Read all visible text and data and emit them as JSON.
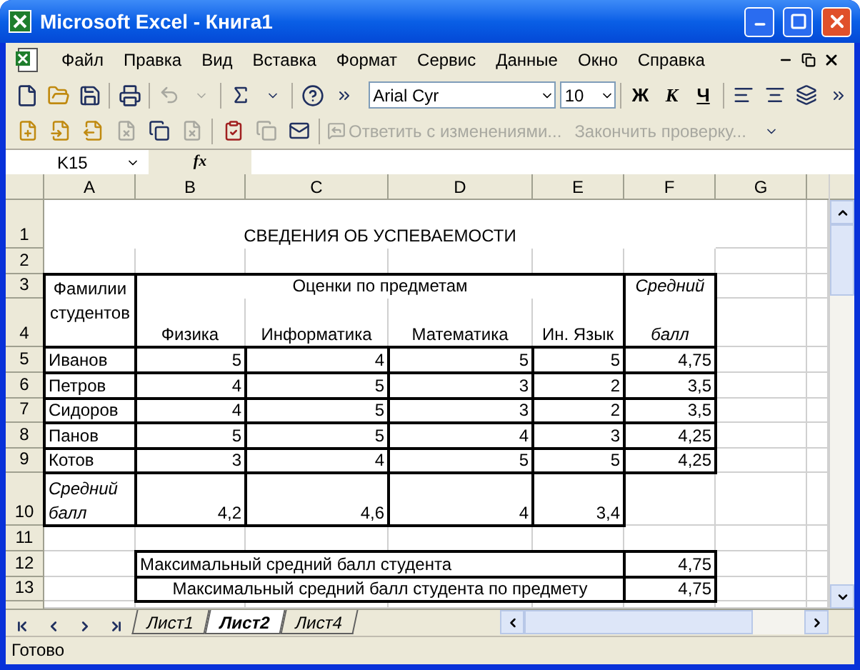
{
  "window": {
    "title": "Microsoft Excel - Книга1"
  },
  "menu": [
    {
      "label": "Файл"
    },
    {
      "label": "Правка"
    },
    {
      "label": "Вид"
    },
    {
      "label": "Вставка"
    },
    {
      "label": "Формат"
    },
    {
      "label": "Сервис"
    },
    {
      "label": "Данные"
    },
    {
      "label": "Окно"
    },
    {
      "label": "Справка"
    }
  ],
  "toolbar": {
    "font": "Arial Cyr",
    "size": "10",
    "bold": "Ж",
    "italic": "К",
    "underline": "Ч"
  },
  "review_toolbar": {
    "reply": "Ответить с изменениями...",
    "end_review": "Закончить проверку..."
  },
  "formula_bar": {
    "name_box": "K15",
    "fx": "fx"
  },
  "sheet": {
    "columns": [
      "A",
      "B",
      "C",
      "D",
      "E",
      "F",
      "G"
    ],
    "rows": [
      "1",
      "2",
      "3",
      "4",
      "5",
      "6",
      "7",
      "8",
      "9",
      "10",
      "11",
      "12",
      "13"
    ],
    "title": "СВЕДЕНИЯ ОБ УСПЕВАЕМОСТИ",
    "header": {
      "names": "Фамилии студентов",
      "grades": "Оценки по предметам",
      "average_top": "Средний",
      "average_bottom": "балл",
      "subjects": [
        "Физика",
        "Информатика",
        "Математика",
        "Ин. Язык"
      ]
    },
    "students": [
      {
        "name": "Иванов",
        "grades": [
          "5",
          "4",
          "5",
          "5"
        ],
        "average": "4,75"
      },
      {
        "name": "Петров",
        "grades": [
          "4",
          "5",
          "3",
          "2"
        ],
        "average": "3,5"
      },
      {
        "name": "Сидоров",
        "grades": [
          "4",
          "5",
          "3",
          "2"
        ],
        "average": "3,5"
      },
      {
        "name": "Панов",
        "grades": [
          "5",
          "5",
          "4",
          "3"
        ],
        "average": "4,25"
      },
      {
        "name": "Котов",
        "grades": [
          "3",
          "4",
          "5",
          "5"
        ],
        "average": "4,25"
      }
    ],
    "average_row": {
      "label": "Средний балл",
      "values": [
        "4,2",
        "4,6",
        "4",
        "3,4"
      ]
    },
    "summary": [
      {
        "label": "Максимальный средний балл студента",
        "value": "4,75",
        "kind": "left"
      },
      {
        "label": "Максимальный средний балл студента по предмету",
        "value": "4,75",
        "kind": "centered"
      }
    ]
  },
  "sheet_tabs": [
    {
      "label": "Лист1",
      "selected": false
    },
    {
      "label": "Лист2",
      "selected": true
    },
    {
      "label": "Лист4",
      "selected": false
    }
  ],
  "status_bar": {
    "text": "Готово"
  }
}
